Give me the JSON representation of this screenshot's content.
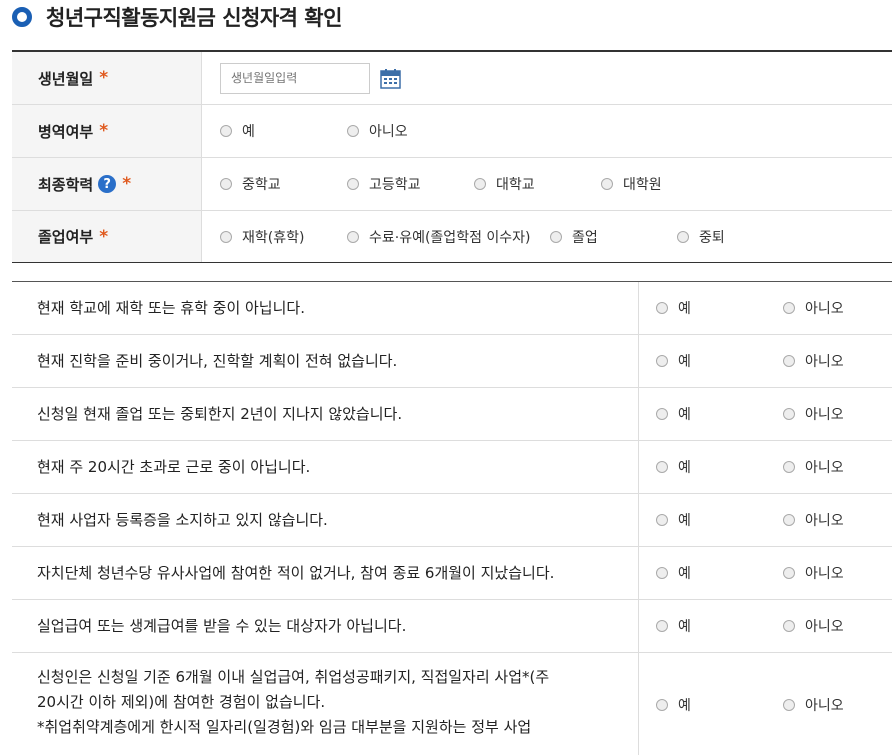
{
  "page": {
    "title": "청년구직활동지원금 신청자격 확인"
  },
  "form": {
    "required_mark": "*",
    "birth": {
      "label": "생년월일",
      "placeholder": "생년월일입력"
    },
    "military": {
      "label": "병역여부",
      "options": [
        "예",
        "아니오"
      ]
    },
    "education": {
      "label": "최종학력",
      "help": "?",
      "options": [
        "중학교",
        "고등학교",
        "대학교",
        "대학원"
      ]
    },
    "graduation": {
      "label": "졸업여부",
      "options": [
        "재학(휴학)",
        "수료·유예(졸업학점 이수자)",
        "졸업",
        "중퇴"
      ]
    }
  },
  "questions": {
    "yes_label": "예",
    "no_label": "아니오",
    "items": [
      {
        "text": "현재 학교에 재학 또는 휴학 중이 아닙니다."
      },
      {
        "text": "현재 진학을 준비 중이거나, 진학할 계획이 전혀 없습니다."
      },
      {
        "text": "신청일 현재 졸업 또는 중퇴한지 2년이 지나지 않았습니다."
      },
      {
        "text": "현재 주 20시간 초과로 근로 중이 아닙니다."
      },
      {
        "text": "현재 사업자 등록증을 소지하고 있지 않습니다."
      },
      {
        "text": "자치단체 청년수당 유사사업에 참여한 적이 없거나, 참여 종료 6개월이 지났습니다."
      },
      {
        "text": "실업급여 또는 생계급여를 받을 수 있는 대상자가 아닙니다."
      },
      {
        "lines": [
          "신청인은 신청일 기준 6개월 이내 실업급여, 취업성공패키지, 직접일자리 사업*(주",
          "20시간 이하 제외)에 참여한 경험이 없습니다.",
          "*취업취약계층에게 한시적 일자리(일경험)와 임금 대부분을 지원하는 정부 사업"
        ]
      }
    ]
  },
  "colors": {
    "accent": "#1a5fb4",
    "required": "#e05a1f",
    "help": "#2a6fc9"
  }
}
